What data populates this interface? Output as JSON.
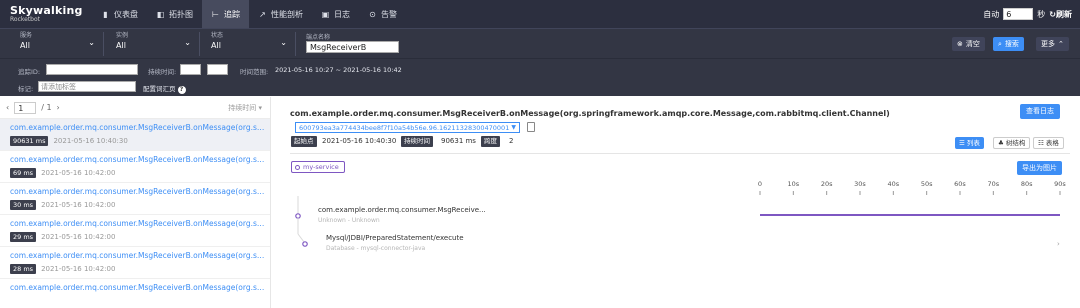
{
  "brand": {
    "name": "Skywalking",
    "sub": "Rocketbot"
  },
  "nav": [
    {
      "icon": "dashboard-icon",
      "glyph": "▮",
      "label": "仪表盘"
    },
    {
      "icon": "topology-icon",
      "glyph": "◧",
      "label": "拓扑图"
    },
    {
      "icon": "trace-icon",
      "glyph": "⊢",
      "label": "追踪",
      "active": true
    },
    {
      "icon": "profile-icon",
      "glyph": "↗",
      "label": "性能剖析"
    },
    {
      "icon": "log-icon",
      "glyph": "▣",
      "label": "日志"
    },
    {
      "icon": "alarm-icon",
      "glyph": "⊙",
      "label": "告警"
    }
  ],
  "top_right": {
    "auto_label": "自动",
    "interval": "6",
    "seconds_label": "秒",
    "refresh_label": "刷新"
  },
  "filters": {
    "service": {
      "label": "服务",
      "value": "All"
    },
    "instance": {
      "label": "实例",
      "value": "All"
    },
    "status": {
      "label": "状态",
      "value": "All"
    },
    "endpoint": {
      "label": "端点名称",
      "value": "MsgReceiverB"
    },
    "clear_label": "清空",
    "search_label": "搜索",
    "more_label": "更多"
  },
  "filters2": {
    "trace_id_label": "追踪ID:",
    "duration_label": "持续时间:",
    "duration_sep": "-",
    "time_range_label": "时间范围:",
    "time_range_value": "2021-05-16 10:27 ~ 2021-05-16 10:42",
    "tag_label": "标记:",
    "tag_placeholder": "请添加标签",
    "tag_config_label": "配置词汇页"
  },
  "list": {
    "page": "1",
    "total": "/ 1",
    "sort_label": "持续时间",
    "items": [
      {
        "endpoint": "com.example.order.mq.consumer.MsgReceiverB.onMessage(org.spri...",
        "duration": "90631 ms",
        "time": "2021-05-16 10:40:30",
        "selected": true
      },
      {
        "endpoint": "com.example.order.mq.consumer.MsgReceiverB.onMessage(org.spri...",
        "duration": "69 ms",
        "time": "2021-05-16 10:42:00"
      },
      {
        "endpoint": "com.example.order.mq.consumer.MsgReceiverB.onMessage(org.spri...",
        "duration": "30 ms",
        "time": "2021-05-16 10:42:00"
      },
      {
        "endpoint": "com.example.order.mq.consumer.MsgReceiverB.onMessage(org.spri...",
        "duration": "29 ms",
        "time": "2021-05-16 10:42:00"
      },
      {
        "endpoint": "com.example.order.mq.consumer.MsgReceiverB.onMessage(org.spri...",
        "duration": "28 ms",
        "time": "2021-05-16 10:42:00"
      },
      {
        "endpoint": "com.example.order.mq.consumer.MsgReceiverB.onMessage(org.spri...",
        "duration": "",
        "time": ""
      }
    ]
  },
  "detail": {
    "title": "com.example.order.mq.consumer.MsgReceiverB.onMessage(org.springframework.amqp.core.Message,com.rabbitmq.client.Channel)",
    "view_log_label": "查看日志",
    "trace_id": "600793ea3a774434bee8f7f10a54b56e.96.16211328300470001",
    "start_label": "起始点",
    "start_value": "2021-05-16 10:40:30",
    "duration_label": "持续时间",
    "duration_value": "90631 ms",
    "depth_label": "跨度",
    "depth_value": "2",
    "view_list": "列表",
    "view_tree": "树结构",
    "view_table": "表格",
    "service_chip": "my-service",
    "export_label": "导出为图片"
  },
  "timeline": {
    "ticks": [
      "0",
      "10s",
      "20s",
      "30s",
      "40s",
      "50s",
      "60s",
      "70s",
      "80s",
      "90s"
    ],
    "max_seconds": 90
  },
  "spans": [
    {
      "name": "com.example.order.mq.consumer.MsgReceive...",
      "sub": "Unknown - Unknown",
      "start_s": 0,
      "duration_s": 90.631
    },
    {
      "name": "Mysql/JDBI/PreparedStatement/execute",
      "sub": "Database - mysql-connector-java",
      "start_s": 90.6,
      "duration_s": 0.01
    }
  ]
}
